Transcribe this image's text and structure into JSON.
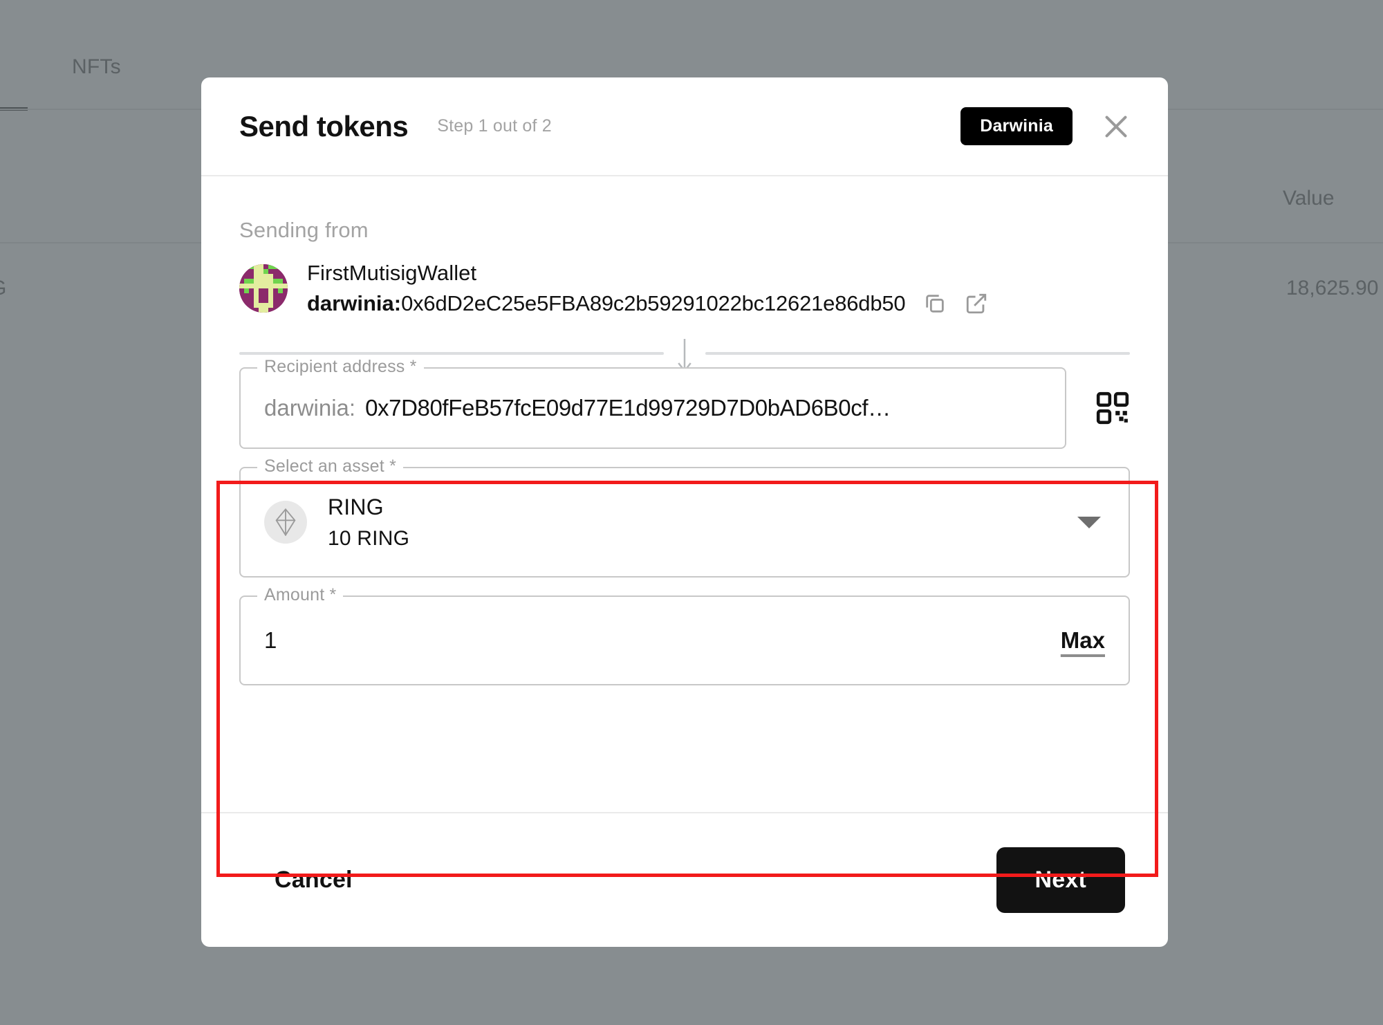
{
  "background": {
    "tab_nfts": "NFTs",
    "column_value_header": "Value",
    "cell_symbol": "G",
    "cell_value": "18,625.90"
  },
  "modal": {
    "title": "Send tokens",
    "step": "Step 1 out of 2",
    "chain_chip": "Darwinia",
    "close_icon": "close-icon",
    "sending_from": {
      "label": "Sending from",
      "wallet_name": "FirstMutisigWallet",
      "address_prefix": "darwinia:",
      "address": "0x6dD2eC25e5FBA89c2b59291022bc12621e86db50",
      "copy_icon": "copy-icon",
      "explorer_icon": "external-link-icon",
      "arrow_icon": "arrow-down-icon"
    },
    "form": {
      "recipient": {
        "legend": "Recipient address *",
        "prefix": "darwinia:",
        "value": "0x7D80fFeB57fcE09d77E1d99729D7D0bAD6B0cf…",
        "qr_icon": "qr-code-icon"
      },
      "asset": {
        "legend": "Select an asset *",
        "symbol": "RING",
        "balance": "10 RING",
        "token_icon": "ring-token-icon",
        "caret_icon": "chevron-down-icon"
      },
      "amount": {
        "legend": "Amount *",
        "value": "1",
        "max_label": "Max"
      }
    },
    "footer": {
      "cancel_label": "Cancel",
      "next_label": "Next"
    }
  },
  "colors": {
    "accent_black": "#121212",
    "annotation_red": "#f21b1b",
    "muted_text": "#a3a3a3",
    "border": "#c8c8c8",
    "backdrop": "#878d90",
    "identicon_purple": "#8b2a6b",
    "identicon_cream": "#e3eda0",
    "identicon_green": "#6fd44e"
  }
}
